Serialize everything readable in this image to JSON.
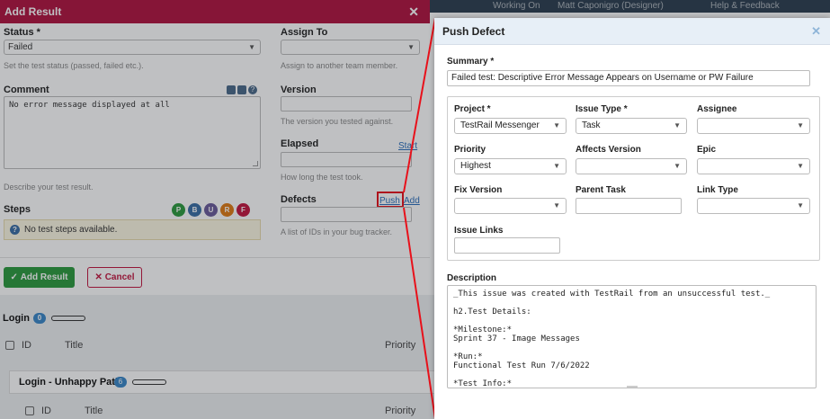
{
  "topbar": {
    "working_on": "Working On",
    "user": "Matt Caponigro (Designer)",
    "help": "Help & Feedback"
  },
  "add_result": {
    "title": "Add Result",
    "status": {
      "label": "Status *",
      "value": "Failed",
      "hint": "Set the test status (passed, failed etc.)."
    },
    "assign_to": {
      "label": "Assign To",
      "value": "",
      "hint": "Assign to another team member."
    },
    "comment": {
      "label": "Comment",
      "value": "No error message displayed at all",
      "hint": "Describe your test result."
    },
    "version": {
      "label": "Version",
      "hint": "The version you tested against."
    },
    "elapsed": {
      "label": "Elapsed",
      "start": "Start",
      "hint": "How long the test took."
    },
    "defects": {
      "label": "Defects",
      "push": "Push",
      "add": "Add",
      "hint": "A list of IDs in your bug tracker."
    },
    "steps": {
      "label": "Steps",
      "message": "No test steps available.",
      "letters": [
        "P",
        "B",
        "U",
        "R",
        "F"
      ]
    },
    "buttons": {
      "add_result": "Add Result",
      "cancel": "Cancel"
    }
  },
  "background": {
    "section1": {
      "title": "Login",
      "count": "0"
    },
    "section2": {
      "title": "Login - Unhappy Path",
      "count": "6"
    },
    "columns": {
      "id": "ID",
      "title": "Title",
      "priority": "Priority"
    }
  },
  "push_defect": {
    "title": "Push Defect",
    "summary": {
      "label": "Summary *",
      "value": "Failed test: Descriptive Error Message Appears on Username or PW Failure"
    },
    "project": {
      "label": "Project *",
      "value": "TestRail Messenger"
    },
    "issue_type": {
      "label": "Issue Type *",
      "value": "Task"
    },
    "assignee": {
      "label": "Assignee",
      "value": ""
    },
    "priority": {
      "label": "Priority",
      "value": "Highest"
    },
    "affects_version": {
      "label": "Affects Version",
      "value": ""
    },
    "epic": {
      "label": "Epic",
      "value": ""
    },
    "fix_version": {
      "label": "Fix Version",
      "value": ""
    },
    "parent_task": {
      "label": "Parent Task",
      "value": ""
    },
    "link_type": {
      "label": "Link Type",
      "value": ""
    },
    "issue_links": {
      "label": "Issue Links",
      "value": ""
    },
    "description": {
      "label": "Description",
      "value": "_This issue was created with TestRail from an unsuccessful test._\n\nh2.Test Details:\n\n*Milestone:*\nSprint 37 - Image Messages\n\n*Run:*\nFunctional Test Run 7/6/2022\n\n*Test Info:*"
    }
  },
  "colors": {
    "header_red": "#b1123f",
    "success_green": "#2c9a3e",
    "callout_red": "#e8111b",
    "link_blue": "#2a6ebb",
    "step_colors": [
      "#2c9a3e",
      "#3a6ea5",
      "#6a5a9a",
      "#e07a14",
      "#c2163f"
    ]
  }
}
